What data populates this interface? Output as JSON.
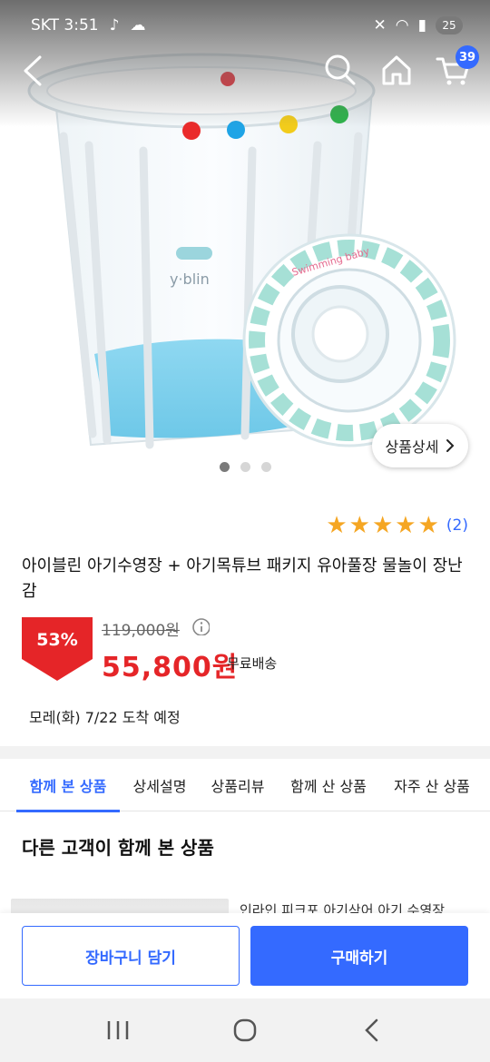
{
  "status_bar": {
    "carrier_time": "SKT 3:51",
    "battery": "25"
  },
  "hero": {
    "cart_count": "39",
    "detail_button": "상품상세",
    "image_count": 3,
    "active_image": 0,
    "pool_logo": "y·blin",
    "ring_text": "Swimming baby"
  },
  "product": {
    "rating_stars": 5,
    "review_count": "(2)",
    "title": "아이블린 아기수영장 + 아기목튜브 패키지 유아풀장 물놀이 장난감",
    "discount": "53%",
    "original_price": "119,000원",
    "sale_price": "55,800원",
    "shipping": "무료배송",
    "delivery": "모레(화) 7/22 도착 예정"
  },
  "tabs": [
    {
      "label": "함께 본 상품",
      "active": true
    },
    {
      "label": "상세설명",
      "active": false
    },
    {
      "label": "상품리뷰",
      "active": false
    },
    {
      "label": "함께 산 상품",
      "active": false
    },
    {
      "label": "자주 산 상품",
      "active": false
    }
  ],
  "section": {
    "title": "다른 고객이 함께 본 상품",
    "related_first_text": "인라인 피크포 아기삭어 아기 수영장"
  },
  "bottom": {
    "cart_button": "장바구니 담기",
    "buy_button": "구매하기"
  },
  "colors": {
    "accent": "#346aff",
    "sale": "#e52528",
    "star": "#f5a623"
  }
}
